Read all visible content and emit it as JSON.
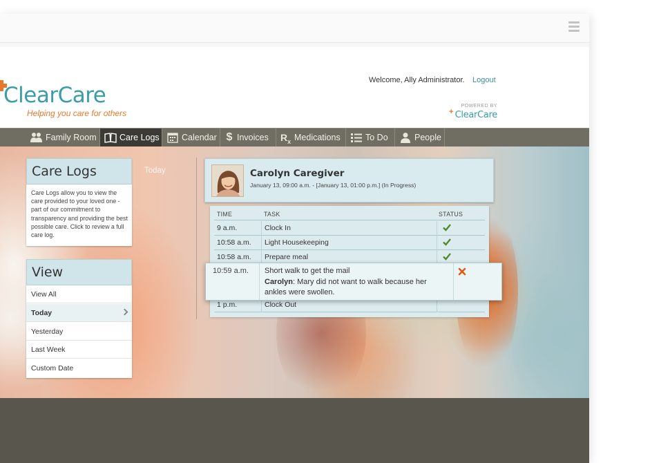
{
  "header": {
    "logo_text": "ClearCare",
    "tagline": "Helping you care for others",
    "welcome": "Welcome, Ally Administrator.",
    "logout": "Logout",
    "powered_by": "POWERED BY",
    "powered_logo_text": "ClearCare"
  },
  "nav": {
    "items": [
      {
        "label": "Family Room",
        "icon": "family-icon"
      },
      {
        "label": "Care Logs",
        "icon": "book-icon"
      },
      {
        "label": "Calendar",
        "icon": "calendar-icon"
      },
      {
        "label": "Invoices",
        "icon": "dollar-icon"
      },
      {
        "label": "Medications",
        "icon": "rx-icon"
      },
      {
        "label": "To Do",
        "icon": "list-icon"
      },
      {
        "label": "People",
        "icon": "person-icon"
      }
    ],
    "active": "Care Logs"
  },
  "care_logs_panel": {
    "title": "Care Logs",
    "description": "Care Logs allow you to view the care provided to your loved one - part of our commitment to transparency and providing the best possible care. Click to review a full care log."
  },
  "view_panel": {
    "title": "View",
    "items": [
      "View All",
      "Today",
      "Yesterday",
      "Last Week",
      "Custom Date"
    ],
    "selected": "Today"
  },
  "date_label": "Today",
  "caregiver": {
    "name": "Carolyn Caregiver",
    "shift": "January 13, 09:00 a.m. - [January 13, 01:00 p.m.] (In Progress)"
  },
  "table": {
    "columns": [
      "TIME",
      "TASK",
      "STATUS"
    ],
    "rows": [
      {
        "time": "9 a.m.",
        "task": "Clock In",
        "status": "done"
      },
      {
        "time": "10:58 a.m.",
        "task": "Light Housekeeping",
        "status": "done"
      },
      {
        "time": "10:58 a.m.",
        "task": "Prepare meal",
        "status": "done"
      },
      {
        "time": "1 p.m.",
        "task": "Clock Out",
        "status": ""
      }
    ]
  },
  "highlight_row": {
    "time": "10:59 a.m.",
    "task": "Short walk to get the mail",
    "note_author": "Carolyn",
    "note_text": ": Mary did not want to walk because her ankles were swollen.",
    "status": "not-done"
  },
  "colors": {
    "brand_teal": "#3a9ea8",
    "brand_orange": "#e8792b",
    "nav_bg": "#706d62",
    "panel_teal": "#cfe5e9",
    "check_green": "#4d8a2a",
    "x_orange": "#e05a12"
  }
}
